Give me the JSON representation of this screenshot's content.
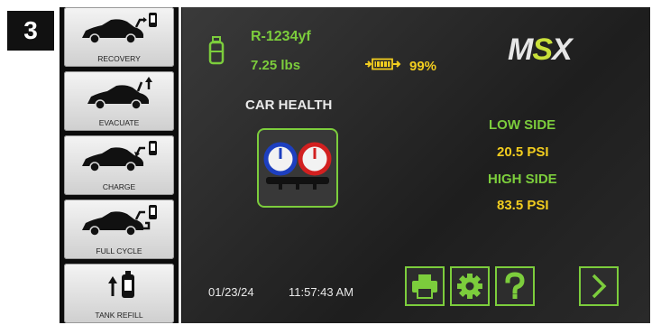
{
  "step_number": "3",
  "sidebar": {
    "items": [
      {
        "label": "RECOVERY",
        "icon": "car-recovery-icon"
      },
      {
        "label": "EVACUATE",
        "icon": "car-evacuate-icon"
      },
      {
        "label": "CHARGE",
        "icon": "car-charge-icon"
      },
      {
        "label": "FULL CYCLE",
        "icon": "car-full-cycle-icon"
      },
      {
        "label": "TANK REFILL",
        "icon": "tank-refill-icon"
      }
    ]
  },
  "refrigerant": {
    "type": "R-1234yf",
    "weight": "7.25 lbs"
  },
  "battery": {
    "percent_label": "99%",
    "level": 0.99
  },
  "logo": {
    "text": "MSX"
  },
  "car_health": {
    "label": "CAR HEALTH"
  },
  "pressures": {
    "low_label": "LOW SIDE",
    "low_value": "20.5 PSI",
    "high_label": "HIGH SIDE",
    "high_value": "83.5 PSI"
  },
  "status": {
    "date": "01/23/24",
    "time": "11:57:43 AM"
  },
  "colors": {
    "accent_green": "#7ccd3c",
    "value_yellow": "#f2cd1f"
  }
}
